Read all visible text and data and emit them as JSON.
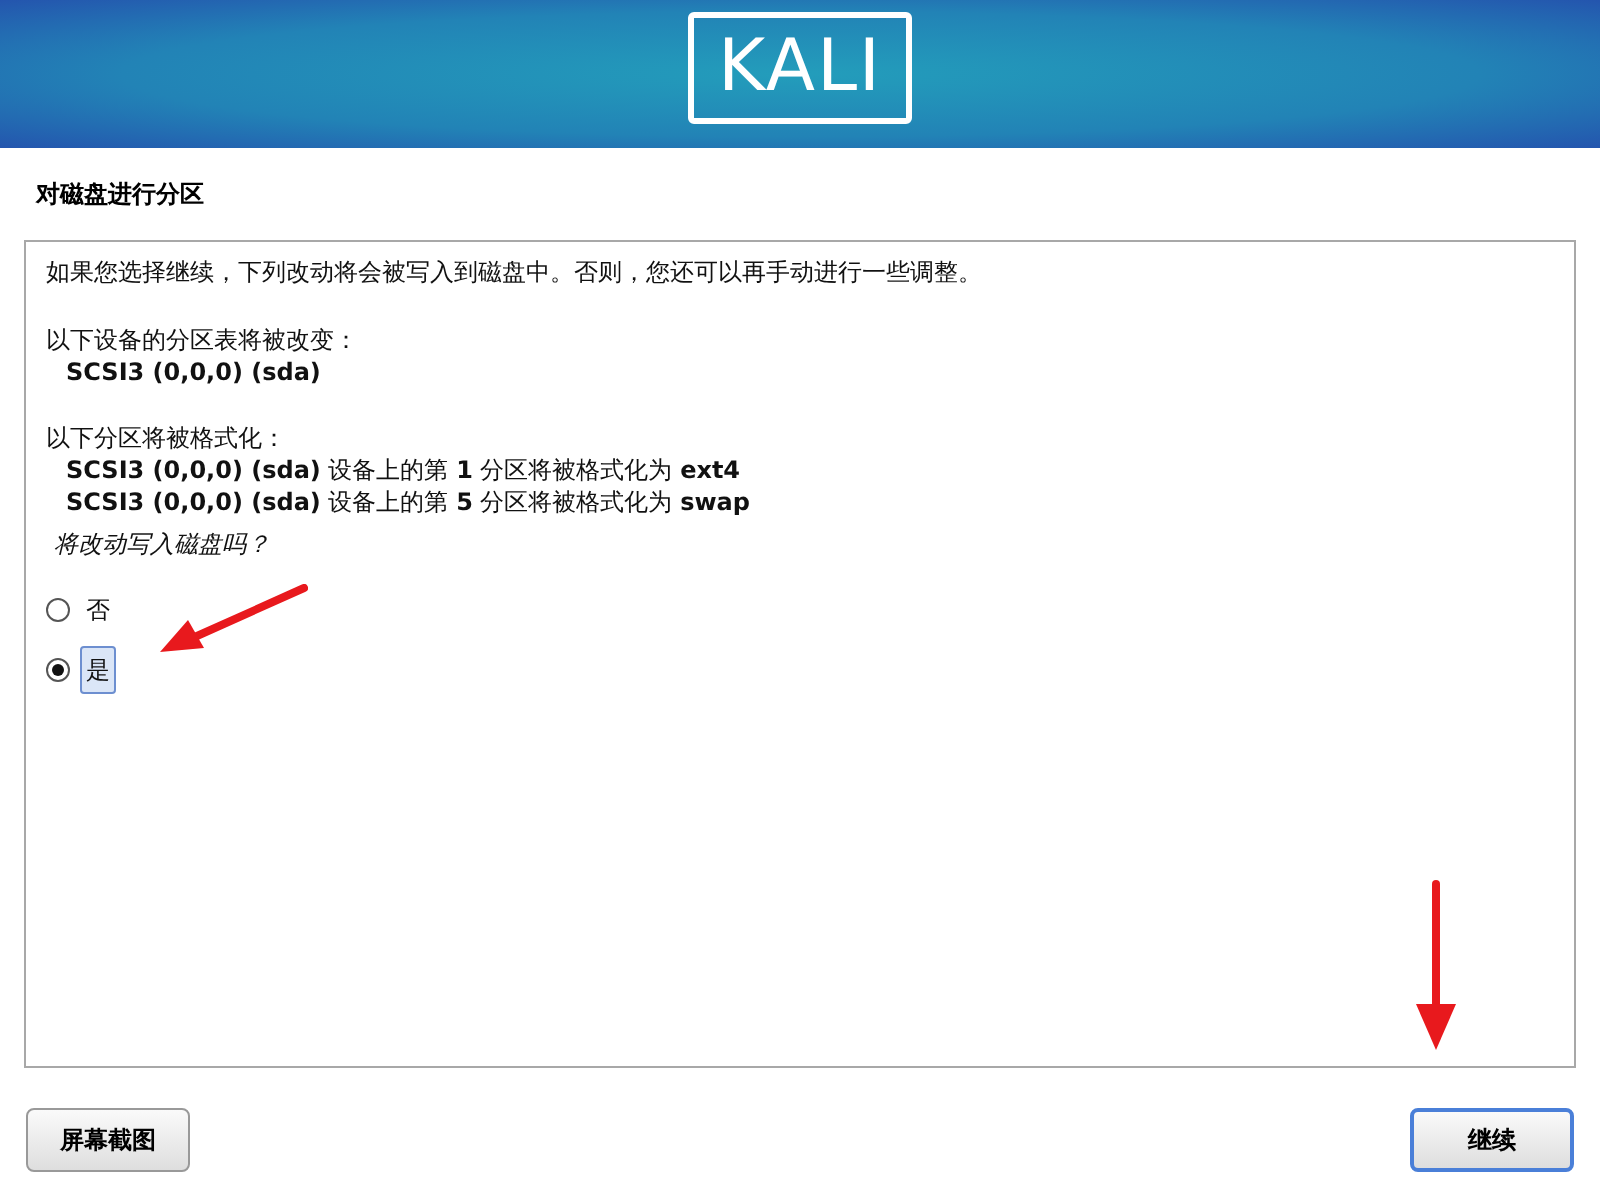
{
  "header": {
    "logo": "KALI"
  },
  "title": "对磁盘进行分区",
  "intro": "如果您选择继续，下列改动将会被写入到磁盘中。否则，您还可以再手动进行一些调整。",
  "sections": [
    {
      "heading": "以下设备的分区表将被改变：",
      "items": [
        "**SCSI3 (0,0,0) (sda)**"
      ]
    },
    {
      "heading": "以下分区将被格式化：",
      "items": [
        "**SCSI3 (0,0,0) (sda)** 设备上的第 **1** 分区将被格式化为 **ext4**",
        "**SCSI3 (0,0,0) (sda)** 设备上的第 **5** 分区将被格式化为 **swap**"
      ]
    }
  ],
  "question": "将改动写入磁盘吗？",
  "options": [
    {
      "label": "否",
      "selected": false
    },
    {
      "label": "是",
      "selected": true
    }
  ],
  "buttons": [
    {
      "label": "屏幕截图",
      "focused": false
    },
    {
      "label": "继续",
      "focused": true
    }
  ]
}
